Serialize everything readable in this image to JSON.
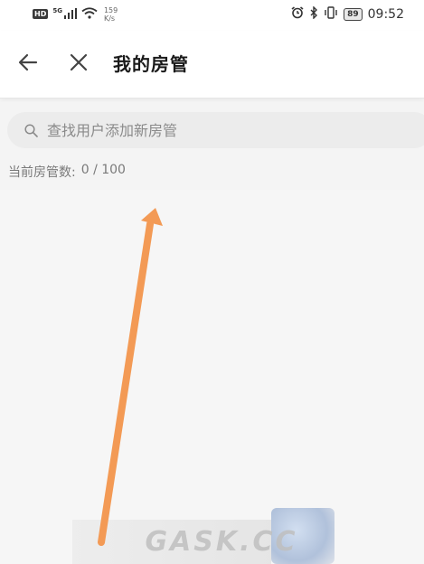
{
  "status_bar": {
    "hd_label": "HD",
    "network_label": "5G",
    "speed_value": "159",
    "speed_unit": "K/s",
    "battery_level": "89",
    "time": "09:52"
  },
  "header": {
    "title": "我的房管"
  },
  "search": {
    "placeholder": "查找用户添加新房管"
  },
  "admin_count": {
    "label": "当前房管数:",
    "value": "0 / 100"
  },
  "watermark": {
    "text": "GASK.CC"
  },
  "colors": {
    "arrow": "#f39a55",
    "header_bg": "#ffffff",
    "page_bg": "#f4f4f4",
    "search_bg": "#ececec"
  }
}
